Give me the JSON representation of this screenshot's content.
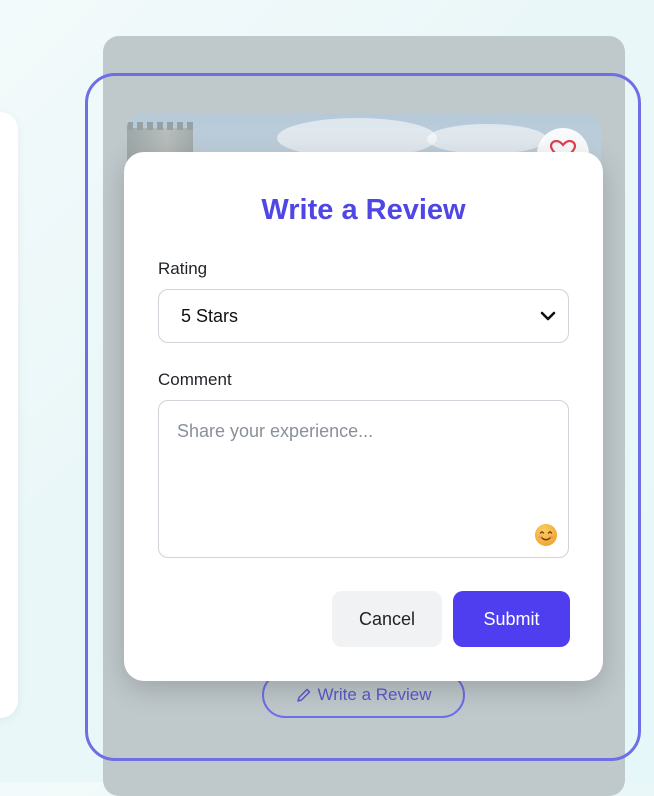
{
  "modal": {
    "title": "Write a Review",
    "rating_label": "Rating",
    "rating_selected": "5 Stars",
    "comment_label": "Comment",
    "comment_placeholder": "Share your experience...",
    "cancel_label": "Cancel",
    "submit_label": "Submit"
  },
  "card": {
    "write_review_label": "Write a Review"
  },
  "colors": {
    "accent": "#4f46e5",
    "submit_bg": "#4f3ef0",
    "focus_ring": "#6e6ee6",
    "heart": "#e0414f"
  }
}
